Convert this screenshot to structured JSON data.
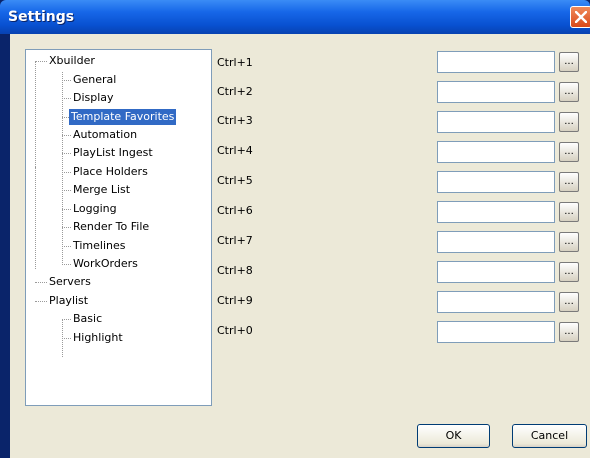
{
  "window": {
    "title": "Settings"
  },
  "tree": {
    "nodes": [
      {
        "label": "Xbuilder"
      },
      {
        "label": "General"
      },
      {
        "label": "Display"
      },
      {
        "label": "Template Favorites",
        "selected": true
      },
      {
        "label": "Automation"
      },
      {
        "label": "PlayList Ingest"
      },
      {
        "label": "Place Holders"
      },
      {
        "label": "Merge List"
      },
      {
        "label": "Logging"
      },
      {
        "label": "Render To File"
      },
      {
        "label": "Timelines"
      },
      {
        "label": "WorkOrders"
      },
      {
        "label": "Servers"
      },
      {
        "label": "Playlist"
      },
      {
        "label": "Basic"
      },
      {
        "label": "Highlight"
      }
    ]
  },
  "shortcuts": [
    {
      "label": "Ctrl+1",
      "value": "",
      "browse": "..."
    },
    {
      "label": "Ctrl+2",
      "value": "",
      "browse": "..."
    },
    {
      "label": "Ctrl+3",
      "value": "",
      "browse": "..."
    },
    {
      "label": "Ctrl+4",
      "value": "",
      "browse": "..."
    },
    {
      "label": "Ctrl+5",
      "value": "",
      "browse": "..."
    },
    {
      "label": "Ctrl+6",
      "value": "",
      "browse": "..."
    },
    {
      "label": "Ctrl+7",
      "value": "",
      "browse": "..."
    },
    {
      "label": "Ctrl+8",
      "value": "",
      "browse": "..."
    },
    {
      "label": "Ctrl+9",
      "value": "",
      "browse": "..."
    },
    {
      "label": "Ctrl+0",
      "value": "",
      "browse": "..."
    }
  ],
  "buttons": {
    "ok": "OK",
    "cancel": "Cancel"
  },
  "colors": {
    "titlebar": "#0850d0",
    "selection": "#316ac5",
    "dialog_face": "#ece9d8"
  },
  "icons": {
    "close": "close-icon"
  }
}
